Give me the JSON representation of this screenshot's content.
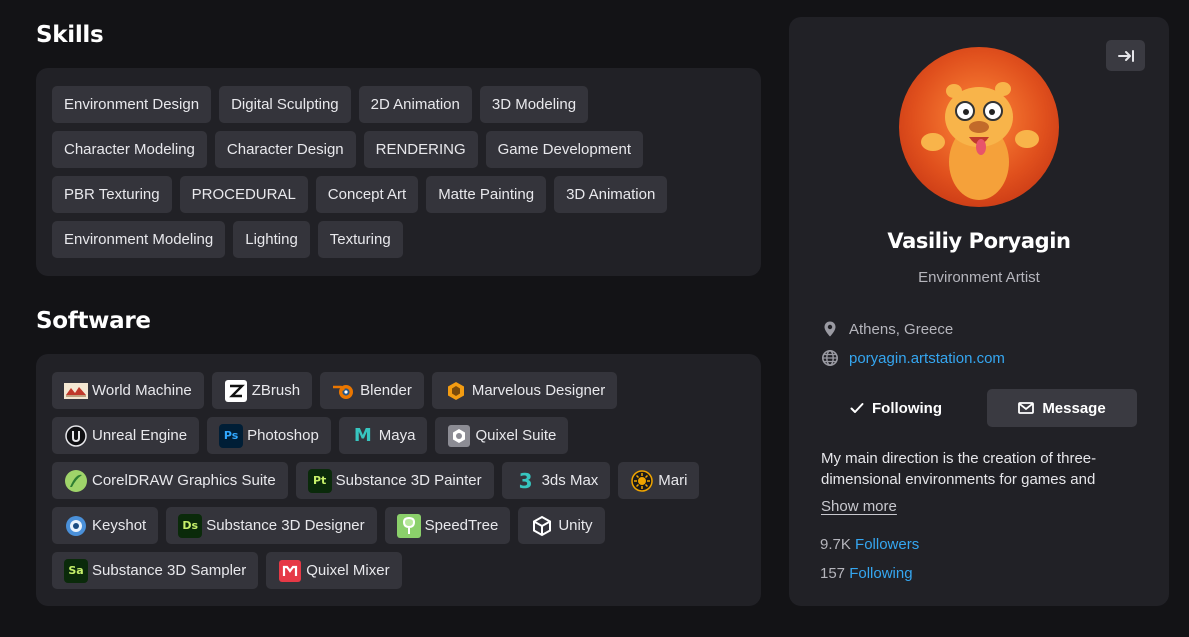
{
  "skills": {
    "title": "Skills",
    "items": [
      "Environment Design",
      "Digital Sculpting",
      "2D Animation",
      "3D Modeling",
      "Character Modeling",
      "Character Design",
      "RENDERING",
      "Game Development",
      "PBR Texturing",
      "PROCEDURAL",
      "Concept Art",
      "Matte Painting",
      "3D Animation",
      "Environment Modeling",
      "Lighting",
      "Texturing"
    ]
  },
  "software": {
    "title": "Software",
    "items": [
      {
        "label": "World Machine",
        "icon": "world-machine-icon"
      },
      {
        "label": "ZBrush",
        "icon": "zbrush-icon"
      },
      {
        "label": "Blender",
        "icon": "blender-icon"
      },
      {
        "label": "Marvelous Designer",
        "icon": "marvelous-designer-icon"
      },
      {
        "label": "Unreal Engine",
        "icon": "unreal-engine-icon"
      },
      {
        "label": "Photoshop",
        "icon": "photoshop-icon",
        "badge": "Ps"
      },
      {
        "label": "Maya",
        "icon": "maya-icon",
        "badge": "M"
      },
      {
        "label": "Quixel Suite",
        "icon": "quixel-suite-icon"
      },
      {
        "label": "CorelDRAW Graphics Suite",
        "icon": "coreldraw-icon"
      },
      {
        "label": "Substance 3D Painter",
        "icon": "substance-painter-icon",
        "badge": "Pt"
      },
      {
        "label": "3ds Max",
        "icon": "3ds-max-icon",
        "badge": "3"
      },
      {
        "label": "Mari",
        "icon": "mari-icon"
      },
      {
        "label": "Keyshot",
        "icon": "keyshot-icon"
      },
      {
        "label": "Substance 3D Designer",
        "icon": "substance-designer-icon",
        "badge": "Ds"
      },
      {
        "label": "SpeedTree",
        "icon": "speedtree-icon"
      },
      {
        "label": "Unity",
        "icon": "unity-icon"
      },
      {
        "label": "Substance 3D Sampler",
        "icon": "substance-sampler-icon",
        "badge": "Sa"
      },
      {
        "label": "Quixel Mixer",
        "icon": "quixel-mixer-icon"
      }
    ]
  },
  "profile": {
    "name": "Vasiliy Poryagin",
    "headline": "Environment Artist",
    "location": "Athens, Greece",
    "website": "poryagin.artstation.com",
    "following_label": "Following",
    "message_label": "Message",
    "bio": "My main direction is the creation of three-dimensional environments for games and",
    "show_more": "Show more",
    "followers_count": "9.7K",
    "followers_label": "Followers",
    "following_count": "157",
    "following_stat_label": "Following"
  },
  "colors": {
    "background": "#131316",
    "panel": "#212126",
    "tag": "#34343b",
    "link": "#35a6f0"
  }
}
